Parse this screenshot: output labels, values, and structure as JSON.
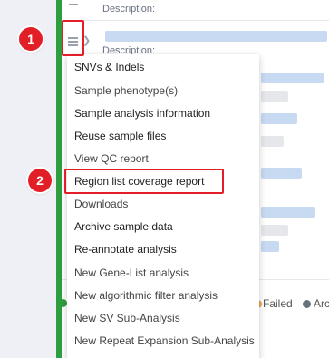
{
  "background": {
    "description_label": "Description:"
  },
  "menu": {
    "items": [
      {
        "label": "SNVs & Indels"
      },
      {
        "label": "Sample phenotype(s)"
      },
      {
        "label": "Sample analysis information"
      },
      {
        "label": "Reuse sample files"
      },
      {
        "label": "View QC report"
      },
      {
        "label": "Region list coverage report"
      },
      {
        "label": "Downloads"
      },
      {
        "label": "Archive sample data"
      },
      {
        "label": "Re-annotate analysis"
      },
      {
        "label": "New Gene-List analysis"
      },
      {
        "label": "New algorithmic filter analysis"
      },
      {
        "label": "New SV Sub-Analysis"
      },
      {
        "label": "New Repeat Expansion Sub-Analysis"
      }
    ]
  },
  "legend": {
    "failed": "Failed",
    "archived_partial": "Arc"
  },
  "annotations": {
    "step1": "1",
    "step2": "2"
  },
  "colors": {
    "accent_green": "#2e9e3e",
    "highlight_red": "#e21f26",
    "failed_dot": "#f0a050",
    "archived_dot": "#6b7180"
  }
}
